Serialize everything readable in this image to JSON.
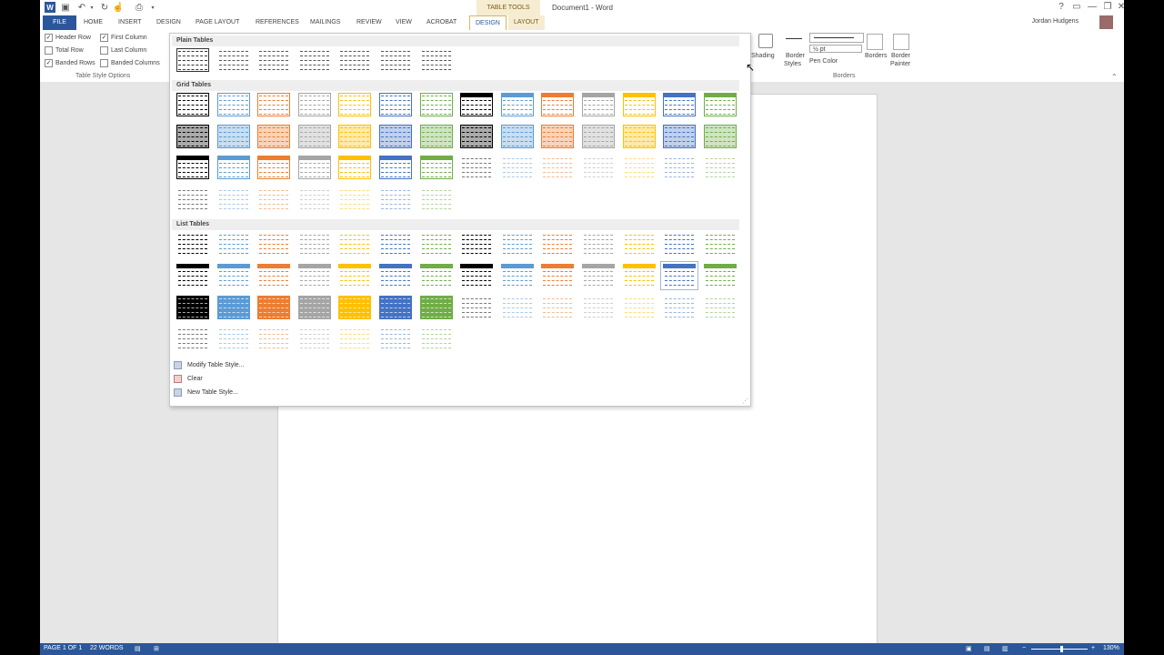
{
  "title_bar": {
    "document_title": "Document1 - Word",
    "context_label": "TABLE TOOLS",
    "win_controls": [
      "?",
      "▭",
      "—",
      "❐",
      "✕"
    ]
  },
  "tabs": {
    "items": [
      {
        "label": "FILE",
        "kind": "file"
      },
      {
        "label": "HOME",
        "kind": "normal"
      },
      {
        "label": "INSERT",
        "kind": "normal"
      },
      {
        "label": "DESIGN",
        "kind": "normal"
      },
      {
        "label": "PAGE LAYOUT",
        "kind": "normal"
      },
      {
        "label": "REFERENCES",
        "kind": "normal"
      },
      {
        "label": "MAILINGS",
        "kind": "normal"
      },
      {
        "label": "REVIEW",
        "kind": "normal"
      },
      {
        "label": "VIEW",
        "kind": "normal"
      },
      {
        "label": "ACROBAT",
        "kind": "normal"
      },
      {
        "label": "DESIGN",
        "kind": "ctx-active"
      },
      {
        "label": "LAYOUT",
        "kind": "ctx"
      }
    ],
    "user_name": "Jordan Hudgens"
  },
  "style_options": {
    "header_row": "Header Row",
    "first_column": "First Column",
    "total_row": "Total Row",
    "last_column": "Last Column",
    "banded_rows": "Banded Rows",
    "banded_columns": "Banded Columns",
    "group_label": "Table Style Options",
    "checked": {
      "header_row": true,
      "first_column": true,
      "total_row": false,
      "last_column": false,
      "banded_rows": true,
      "banded_columns": false
    }
  },
  "borders": {
    "shading": "Shading",
    "border_styles_1": "Border",
    "border_styles_2": "Styles",
    "pen_weight": "½ pt",
    "pen_color": "Pen Color",
    "borders_1": "Borders",
    "border_painter_1": "Border",
    "border_painter_2": "Painter",
    "group_label": "Borders"
  },
  "gallery": {
    "plain_tables": "Plain Tables",
    "grid_tables": "Grid Tables",
    "list_tables": "List Tables",
    "menu": {
      "modify": "Modify Table Style...",
      "clear": "Clear",
      "new": "New Table Style..."
    },
    "colors": [
      "#000000",
      "#5b9bd5",
      "#ed7d31",
      "#a5a5a5",
      "#ffc000",
      "#4472c4",
      "#70ad47"
    ]
  },
  "status_bar": {
    "page": "PAGE 1 OF 1",
    "words": "22 WORDS",
    "zoom": "130%"
  }
}
